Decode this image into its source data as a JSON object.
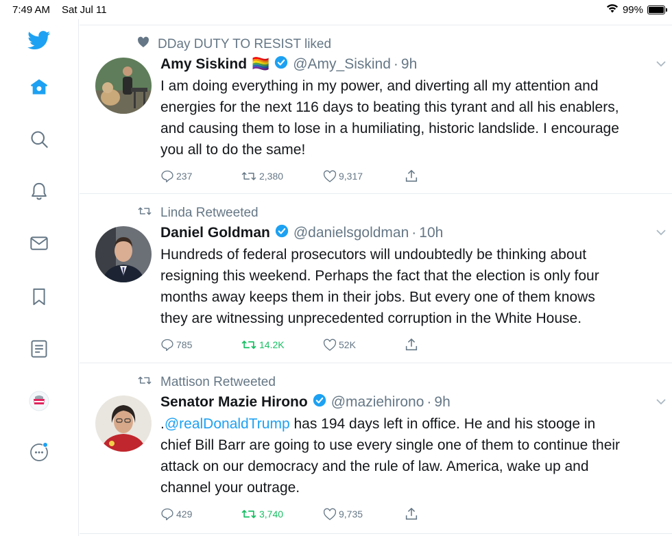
{
  "status_bar": {
    "time": "7:49 AM",
    "date": "Sat Jul 11",
    "battery": "99%",
    "battery_level": 0.99
  },
  "sidebar": {
    "items": [
      {
        "icon": "twitter-logo-icon"
      },
      {
        "icon": "home-icon"
      },
      {
        "icon": "search-icon"
      },
      {
        "icon": "bell-icon"
      },
      {
        "icon": "mail-icon"
      },
      {
        "icon": "bookmark-icon"
      },
      {
        "icon": "list-icon"
      },
      {
        "icon": "profile-avatar-icon"
      },
      {
        "icon": "more-icon"
      }
    ]
  },
  "colors": {
    "accent": "#1da1f2",
    "retweet_active": "#17bf63",
    "muted": "#657786",
    "text": "#14171a"
  },
  "tweets": [
    {
      "context": "DDay DUTY TO RESIST liked",
      "context_icon": "heart-filled-icon",
      "name": "Amy Siskind",
      "emoji": "🏳️‍🌈",
      "verified": true,
      "handle": "@Amy_Siskind",
      "time": "9h",
      "text_lines": [
        "I am doing everything in my power, and diverting all my attention and",
        "energies for the next 116 days to beating this tyrant and all his enablers,",
        "and causing them to lose in a humiliating, historic landslide. I encourage",
        "you all to do the same!"
      ],
      "replies": "237",
      "retweets": "2,380",
      "likes": "9,317",
      "retweeted_by_me": false
    },
    {
      "context": "Linda Retweeted",
      "context_icon": "retweet-icon",
      "name": "Daniel Goldman",
      "verified": true,
      "handle": "@danielsgoldman",
      "time": "10h",
      "text_lines": [
        "Hundreds of federal prosecutors will undoubtedly be thinking about",
        "resigning this weekend. Perhaps the fact that the election is only four",
        "months away keeps them in their jobs. But every one of them knows",
        "they are witnessing unprecedented corruption in the White House."
      ],
      "replies": "785",
      "retweets": "14.2K",
      "likes": "52K",
      "retweeted_by_me": true
    },
    {
      "context": "Mattison Retweeted",
      "context_icon": "retweet-icon",
      "name": "Senator Mazie Hirono",
      "verified": true,
      "handle": "@maziehirono",
      "time": "9h",
      "mention": "@realDonaldTrump",
      "text_first_prefix": ".",
      "text_first_rest": " has 194 days left in office. He and his stooge in",
      "text_lines": [
        "chief Bill Barr are going to use every single one of them to continue their",
        "attack on our democracy and the rule of law. America, wake up and",
        "channel your outrage."
      ],
      "replies": "429",
      "retweets": "3,740",
      "likes": "9,735",
      "retweeted_by_me": true
    }
  ]
}
